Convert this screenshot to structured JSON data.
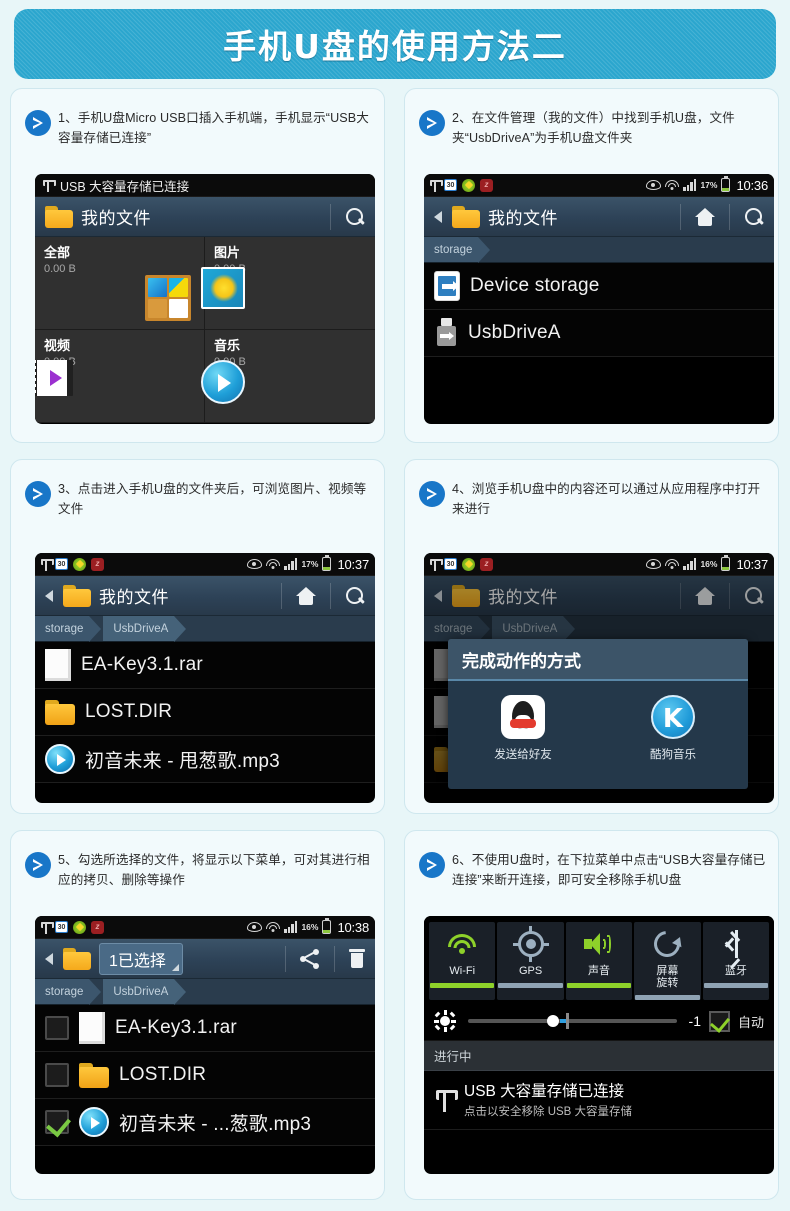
{
  "header": {
    "title": "手机U盘的使用方法二"
  },
  "panels": [
    {
      "caption": "1、手机U盘Micro USB口插入手机端，手机显示“USB大容量存储已连接”",
      "statusbar_text": "USB 大容量存储已连接",
      "toolbar": {
        "title": "我的文件",
        "search_icon": "search-icon"
      },
      "tiles": [
        {
          "name": "全部",
          "size": "0.00 B"
        },
        {
          "name": "图片",
          "size": "0.00 B"
        },
        {
          "name": "视频",
          "size": "0.00 B"
        },
        {
          "name": "音乐",
          "size": "0.00 B"
        }
      ]
    },
    {
      "caption": "2、在文件管理（我的文件）中找到手机U盘，文件夹“UsbDriveA”为手机U盘文件夹",
      "statusbar": {
        "battery_pct": "17%",
        "time": "10:36"
      },
      "toolbar": {
        "title": "我的文件"
      },
      "crumbs": [
        "storage"
      ],
      "rows": [
        {
          "label": "Device storage",
          "icon": "device-storage-icon"
        },
        {
          "label": "UsbDriveA",
          "icon": "usb-drive-icon"
        }
      ]
    },
    {
      "caption": "3、点击进入手机U盘的文件夹后，可浏览图片、视频等文件",
      "statusbar": {
        "battery_pct": "17%",
        "time": "10:37"
      },
      "toolbar": {
        "title": "我的文件"
      },
      "crumbs": [
        "storage",
        "UsbDriveA"
      ],
      "rows": [
        {
          "label": "EA-Key3.1.rar",
          "icon": "file-icon"
        },
        {
          "label": "LOST.DIR",
          "icon": "folder-icon"
        },
        {
          "label": "初音未来 - 甩葱歌.mp3",
          "icon": "music-icon"
        }
      ]
    },
    {
      "caption": "4、浏览手机U盘中的内容还可以通过从应用程序中打开来进行",
      "statusbar": {
        "battery_pct": "16%",
        "time": "10:37"
      },
      "toolbar": {
        "title": "我的文件"
      },
      "crumbs": [
        "storage",
        "UsbDriveA"
      ],
      "dialog": {
        "title": "完成动作的方式",
        "apps": [
          {
            "label": "发送给好友",
            "icon": "qq-icon"
          },
          {
            "label": "酷狗音乐",
            "icon": "kugou-icon"
          }
        ]
      }
    },
    {
      "caption": "5、勾选所选择的文件，将显示以下菜单，可对其进行相应的拷贝、删除等操作",
      "statusbar": {
        "battery_pct": "16%",
        "time": "10:38"
      },
      "toolbar": {
        "selected_label": "1已选择"
      },
      "crumbs": [
        "storage",
        "UsbDriveA"
      ],
      "rows": [
        {
          "label": "EA-Key3.1.rar",
          "icon": "file-icon",
          "checked": false
        },
        {
          "label": "LOST.DIR",
          "icon": "folder-icon",
          "checked": false
        },
        {
          "label": "初音未来 - ...葱歌.mp3",
          "icon": "music-icon",
          "checked": true
        }
      ]
    },
    {
      "caption": "6、不使用U盘时，在下拉菜单中点击“USB大容量存储已连接”来断开连接，即可安全移除手机U盘",
      "toggles": [
        {
          "label": "Wi-Fi",
          "state": "on"
        },
        {
          "label": "GPS",
          "state": "off"
        },
        {
          "label": "声音",
          "state": "on"
        },
        {
          "label": "屏幕\n旋转",
          "state": "off"
        },
        {
          "label": "蓝牙",
          "state": "off"
        }
      ],
      "brightness": {
        "value": "-1",
        "auto_label": "自动"
      },
      "notification_section": "进行中",
      "notification": {
        "title": "USB 大容量存储已连接",
        "subtitle": "点击以安全移除 USB 大容量存储"
      }
    }
  ],
  "colors": {
    "brand": "#2ba6ce",
    "accent_blue": "#1876c8",
    "on_green": "#8ed12a",
    "page_bg": "#e8f6f8"
  }
}
